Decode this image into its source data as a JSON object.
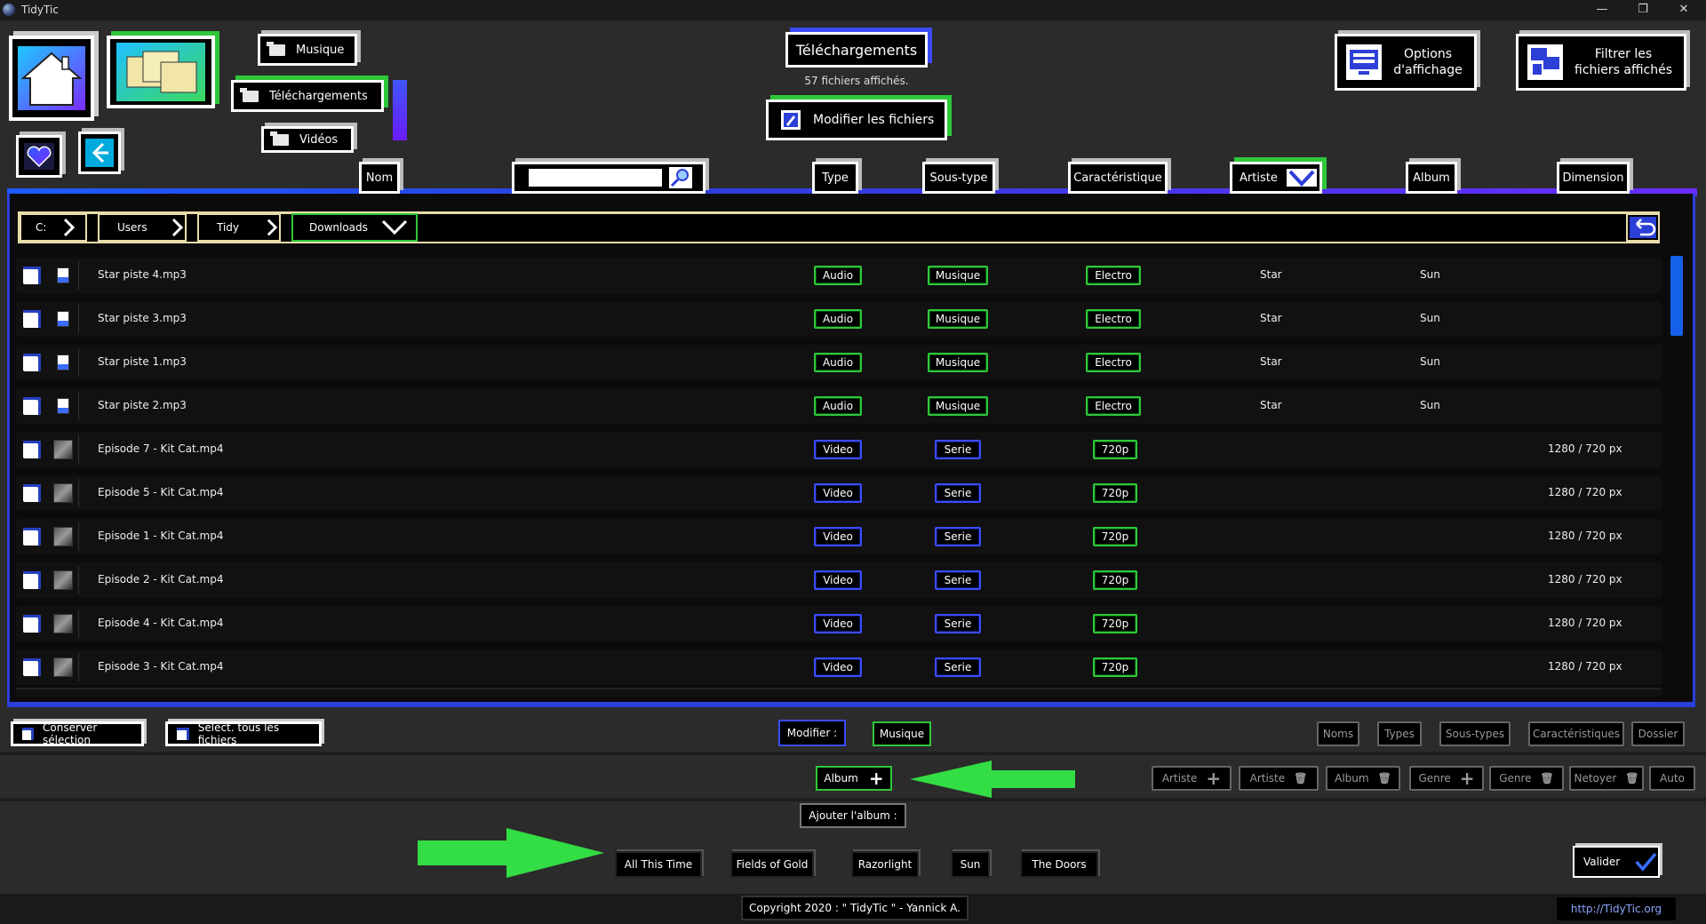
{
  "app": {
    "title": "TidyTic",
    "win_min": "—",
    "win_max": "❐",
    "win_close": "✕"
  },
  "nav": {
    "music": "Musique",
    "downloads": "Téléchargements",
    "videos": "Vidéos"
  },
  "header": {
    "folder_title": "Téléchargements",
    "files_count": "57 fichiers affichés.",
    "modify_files": "Modifier les fichiers",
    "display_options_l1": "Options",
    "display_options_l2": "d'affichage",
    "filter_l1": "Filtrer les",
    "filter_l2": "fichiers affichés"
  },
  "columns": {
    "name": "Nom",
    "type": "Type",
    "subtype": "Sous-type",
    "feature": "Caractéristique",
    "artist": "Artiste",
    "album": "Album",
    "dimension": "Dimension"
  },
  "search": {
    "placeholder": ""
  },
  "breadcrumb": [
    "C:",
    "Users",
    "Tidy",
    "Downloads"
  ],
  "files": [
    {
      "name": "Star piste 4.mp3",
      "type": "Audio",
      "subtype": "Musique",
      "feature": "Electro",
      "artist": "Star",
      "album": "Sun",
      "dimension": "",
      "kind": "audio"
    },
    {
      "name": "Star piste 3.mp3",
      "type": "Audio",
      "subtype": "Musique",
      "feature": "Electro",
      "artist": "Star",
      "album": "Sun",
      "dimension": "",
      "kind": "audio"
    },
    {
      "name": "Star piste 1.mp3",
      "type": "Audio",
      "subtype": "Musique",
      "feature": "Electro",
      "artist": "Star",
      "album": "Sun",
      "dimension": "",
      "kind": "audio"
    },
    {
      "name": "Star piste 2.mp3",
      "type": "Audio",
      "subtype": "Musique",
      "feature": "Electro",
      "artist": "Star",
      "album": "Sun",
      "dimension": "",
      "kind": "audio"
    },
    {
      "name": "Episode 7 - Kit Cat.mp4",
      "type": "Video",
      "subtype": "Serie",
      "feature": "720p",
      "artist": "",
      "album": "",
      "dimension": "1280 / 720 px",
      "kind": "video"
    },
    {
      "name": "Episode 5 - Kit Cat.mp4",
      "type": "Video",
      "subtype": "Serie",
      "feature": "720p",
      "artist": "",
      "album": "",
      "dimension": "1280 / 720 px",
      "kind": "video"
    },
    {
      "name": "Episode 1 - Kit Cat.mp4",
      "type": "Video",
      "subtype": "Serie",
      "feature": "720p",
      "artist": "",
      "album": "",
      "dimension": "1280 / 720 px",
      "kind": "video"
    },
    {
      "name": "Episode 2 - Kit Cat.mp4",
      "type": "Video",
      "subtype": "Serie",
      "feature": "720p",
      "artist": "",
      "album": "",
      "dimension": "1280 / 720 px",
      "kind": "video"
    },
    {
      "name": "Episode 4 - Kit Cat.mp4",
      "type": "Video",
      "subtype": "Serie",
      "feature": "720p",
      "artist": "",
      "album": "",
      "dimension": "1280 / 720 px",
      "kind": "video"
    },
    {
      "name": "Episode 3 - Kit Cat.mp4",
      "type": "Video",
      "subtype": "Serie",
      "feature": "720p",
      "artist": "",
      "album": "",
      "dimension": "1280 / 720 px",
      "kind": "video"
    }
  ],
  "actions": {
    "keep_selection": "Conserver sélection",
    "select_all": "Select. tous les fichiers",
    "modify_label": "Modifier :",
    "modify_value": "Musique",
    "album_btn": "Album",
    "add_album": "Ajouter l'album :",
    "validate": "Valider"
  },
  "right_tags_row1": [
    "Noms",
    "Types",
    "Sous-types",
    "Caractéristiques",
    "Dossier"
  ],
  "right_tags_row2": [
    {
      "label": "Artiste",
      "icon": "plus-icon"
    },
    {
      "label": "Artiste",
      "icon": "trash-icon"
    },
    {
      "label": "Album",
      "icon": "trash-icon"
    },
    {
      "label": "Genre",
      "icon": "plus-icon"
    },
    {
      "label": "Genre",
      "icon": "trash-icon"
    },
    {
      "label": "Netoyer",
      "icon": "trash-icon"
    },
    {
      "label": "Auto",
      "icon": ""
    }
  ],
  "albums": [
    "All This Time",
    "Fields of Gold",
    "Razorlight",
    "Sun",
    "The Doors"
  ],
  "footer": {
    "copyright": "Copyright 2020 : \" TidyTic \" - Yannick A.",
    "link": "http://TidyTic.org"
  },
  "colors": {
    "green": "#2ec83a",
    "blue": "#2b3fd9",
    "purple": "#5a2cff",
    "arrow": "#33dd44"
  }
}
